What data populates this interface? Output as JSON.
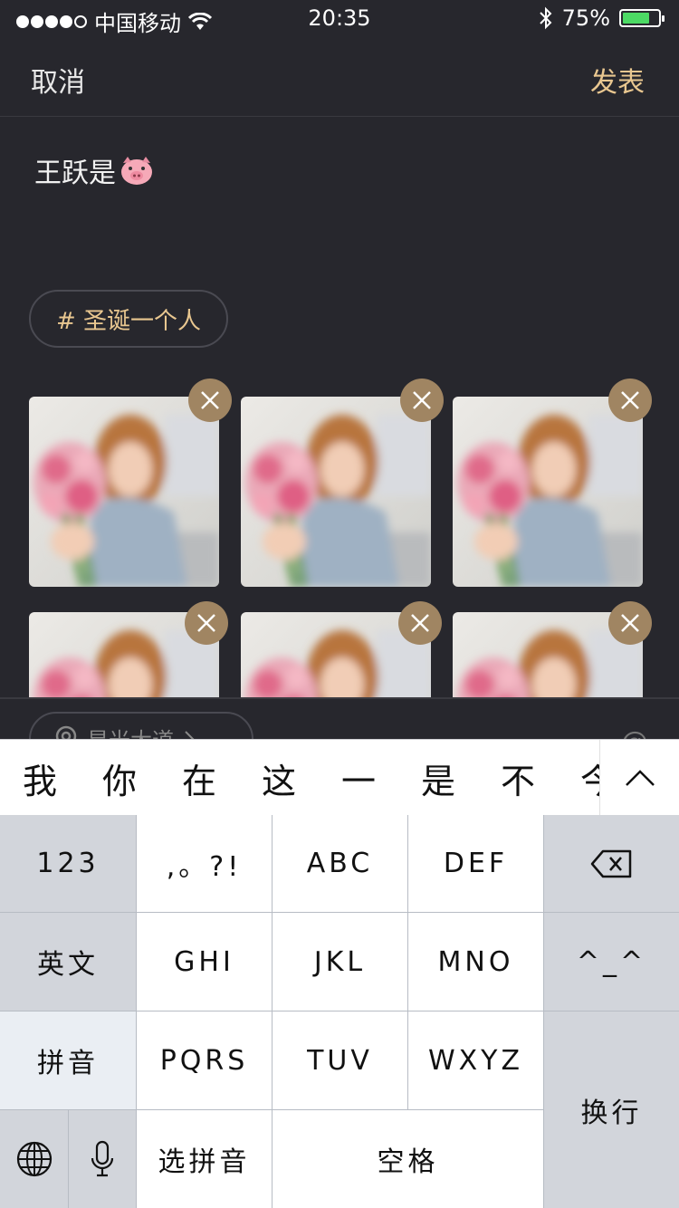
{
  "status_bar": {
    "carrier": "中国移动",
    "time": "20:35",
    "battery_percent": "75%",
    "battery_level": 0.75,
    "battery_color": "#4cd964"
  },
  "nav": {
    "cancel_label": "取消",
    "post_label": "发表",
    "post_color": "#e9c790"
  },
  "compose": {
    "text": "王跃是",
    "emoji_icon": "pig-face-icon",
    "topic_tag": "# 圣诞一个人"
  },
  "photos": {
    "count_visible": 6,
    "remove_icon": "close-icon"
  },
  "location": {
    "label": "星光大道",
    "icon": "location-pin-icon",
    "chevron": "chevron-right-icon"
  },
  "mention_icon": "@",
  "keyboard": {
    "candidates": [
      "我",
      "你",
      "在",
      "这",
      "一",
      "是",
      "不",
      "今"
    ],
    "row1": [
      "123",
      ",。?!",
      "ABC",
      "DEF"
    ],
    "row2": [
      "英文",
      "GHI",
      "JKL",
      "MNO",
      "^_^"
    ],
    "row3": [
      "拼音",
      "PQRS",
      "TUV",
      "WXYZ"
    ],
    "row4": [
      "选拼音",
      "空格"
    ],
    "return_label": "换行"
  }
}
